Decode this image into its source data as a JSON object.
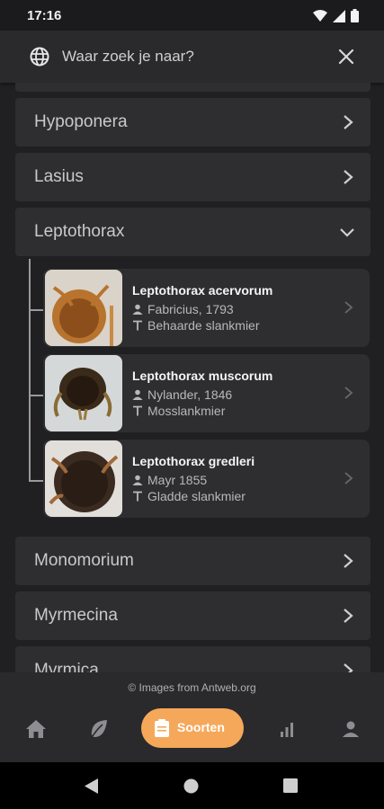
{
  "status": {
    "time": "17:16"
  },
  "search": {
    "placeholder": "Waar zoek je naar?"
  },
  "genera": [
    "Hypoponera",
    "Lasius",
    "Leptothorax",
    "Monomorium",
    "Myrmecina",
    "Myrmica"
  ],
  "species": [
    {
      "name": "Leptothorax acervorum",
      "author": "Fabricius, 1793",
      "common": "Behaarde slankmier"
    },
    {
      "name": "Leptothorax muscorum",
      "author": "Nylander, 1846",
      "common": "Mosslankmier"
    },
    {
      "name": "Leptothorax gredleri",
      "author": "Mayr 1855",
      "common": "Gladde slankmier"
    }
  ],
  "footer": {
    "credit": "© Images from Antweb.org"
  },
  "nav": {
    "active_label": "Soorten"
  },
  "colors": {
    "accent": "#f5a85a",
    "background": "#202022",
    "card": "#2e2e31"
  }
}
